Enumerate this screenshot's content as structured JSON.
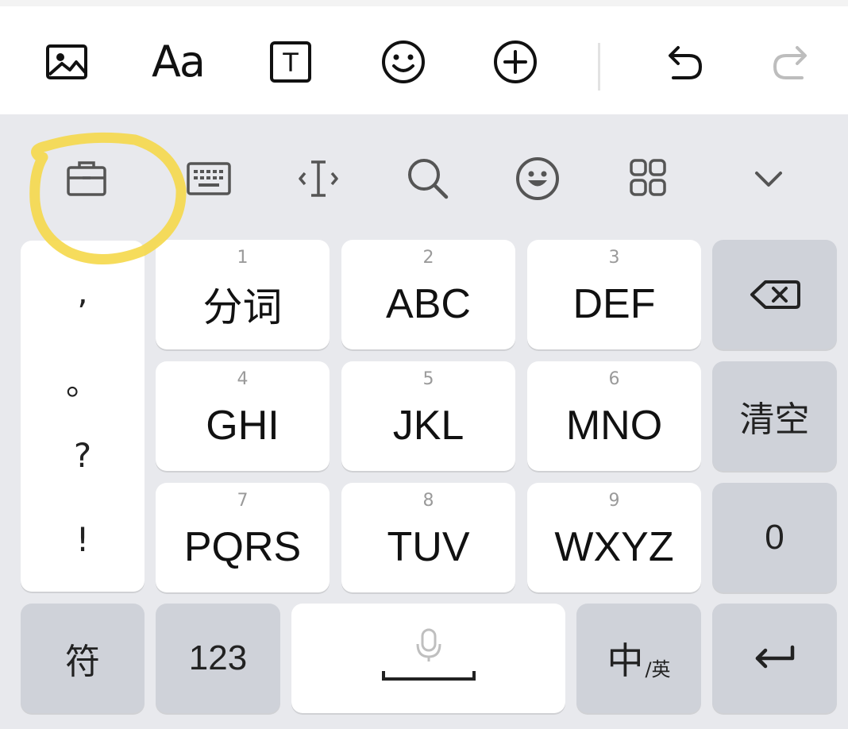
{
  "toolbar": {
    "items": [
      {
        "name": "image-icon"
      },
      {
        "name": "font-icon",
        "label": "Aa"
      },
      {
        "name": "text-box-icon",
        "label": "T"
      },
      {
        "name": "emoji-icon"
      },
      {
        "name": "add-icon"
      },
      {
        "name": "undo-icon"
      },
      {
        "name": "redo-icon",
        "disabled": true
      }
    ]
  },
  "function_row": {
    "items": [
      {
        "name": "clipboard-icon",
        "highlighted": true
      },
      {
        "name": "keyboard-icon"
      },
      {
        "name": "cursor-icon"
      },
      {
        "name": "search-icon"
      },
      {
        "name": "sticker-emoji-icon"
      },
      {
        "name": "apps-grid-icon"
      },
      {
        "name": "chevron-down-icon"
      }
    ]
  },
  "punctuation": [
    ",",
    "。",
    "?",
    "!"
  ],
  "keys": [
    {
      "num": "1",
      "label": "分词"
    },
    {
      "num": "2",
      "label": "ABC"
    },
    {
      "num": "3",
      "label": "DEF"
    },
    {
      "num": "4",
      "label": "GHI"
    },
    {
      "num": "5",
      "label": "JKL"
    },
    {
      "num": "6",
      "label": "MNO"
    },
    {
      "num": "7",
      "label": "PQRS"
    },
    {
      "num": "8",
      "label": "TUV"
    },
    {
      "num": "9",
      "label": "WXYZ"
    }
  ],
  "side_keys": {
    "backspace": "backspace-icon",
    "clear": "清空",
    "zero": "0",
    "enter": "enter-icon"
  },
  "bottom_row": {
    "symbols": "符",
    "numbers": "123",
    "space": "space-icon",
    "lang_main": "中",
    "lang_sub": "/英"
  },
  "colors": {
    "keyboard_bg": "#e8e9ed",
    "key_white": "#ffffff",
    "key_gray": "#cfd2d9",
    "highlight_yellow": "#f5d84a"
  }
}
